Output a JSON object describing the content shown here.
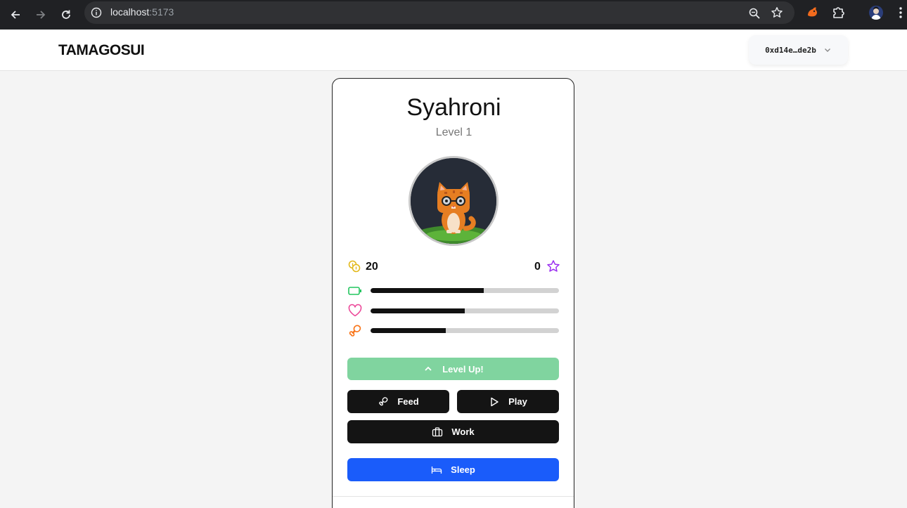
{
  "browser": {
    "url_host": "localhost",
    "url_port": ":5173",
    "icons": [
      "back-icon",
      "forward-icon",
      "reload-icon",
      "site-info-icon",
      "zoom-icon",
      "bookmark-star-icon",
      "extension-icon",
      "puzzle-icon",
      "profile-avatar",
      "menu-icon"
    ]
  },
  "header": {
    "brand": "TAMAGOSUI",
    "wallet_address": "0xd14e…de2b"
  },
  "pet": {
    "name": "Syahroni",
    "level_label": "Level 1",
    "coins": "20",
    "experience": "0",
    "stats": {
      "energy": 0.6,
      "happiness": 0.5,
      "hunger": 0.4
    }
  },
  "actions": {
    "level_up": "Level Up!",
    "feed": "Feed",
    "play": "Play",
    "work": "Work",
    "sleep": "Sleep"
  },
  "colors": {
    "coin": "#e2b714",
    "star": "#9b30f0",
    "energy": "#22c55e",
    "happiness": "#ec4899",
    "hunger": "#f97316",
    "level_up_bg": "#80d49f",
    "sleep_bg": "#1a5cfa"
  }
}
